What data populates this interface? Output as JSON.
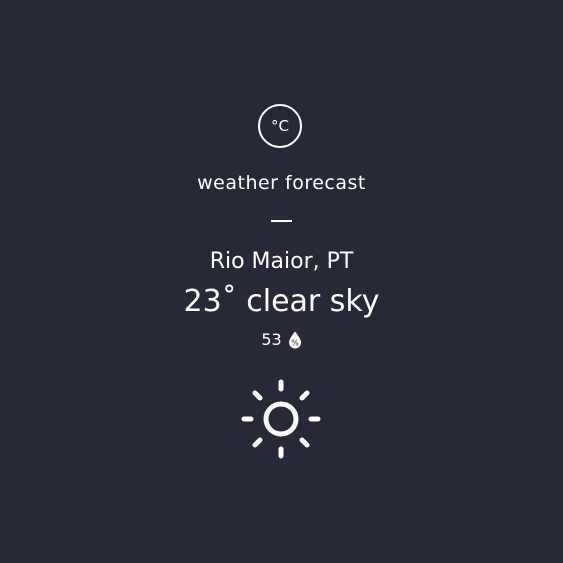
{
  "unit_toggle": {
    "label": "°C"
  },
  "header": {
    "title": "weather forecast"
  },
  "weather": {
    "location": "Rio Maior, PT",
    "temperature": "23",
    "degree_symbol": "˚",
    "description": "clear sky",
    "humidity": "53",
    "icon": "sun-icon"
  },
  "colors": {
    "background": "#282936",
    "text": "#ffffff"
  }
}
